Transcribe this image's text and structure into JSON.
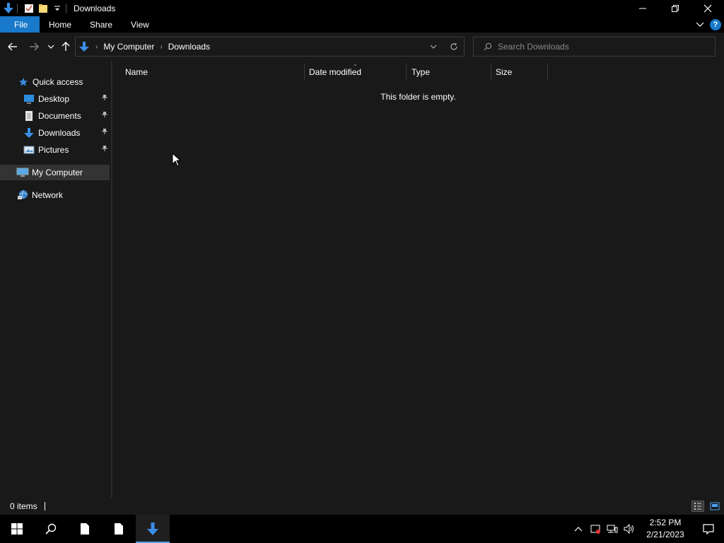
{
  "window": {
    "title": "Downloads",
    "controls": {
      "minimize": "—",
      "restore": "❐",
      "close": "✕"
    }
  },
  "ribbon": {
    "tabs": [
      "File",
      "Home",
      "Share",
      "View"
    ],
    "help": "?"
  },
  "address": {
    "crumbs": [
      "My Computer",
      "Downloads"
    ],
    "search_placeholder": "Search Downloads"
  },
  "nav": {
    "quick_access": "Quick access",
    "items": [
      {
        "label": "Desktop",
        "icon": "desktop-icon",
        "pinned": true
      },
      {
        "label": "Documents",
        "icon": "documents-icon",
        "pinned": true
      },
      {
        "label": "Downloads",
        "icon": "downloads-icon",
        "pinned": true
      },
      {
        "label": "Pictures",
        "icon": "pictures-icon",
        "pinned": true
      }
    ],
    "my_computer": "My Computer",
    "network": "Network"
  },
  "content": {
    "columns": [
      "Name",
      "Date modified",
      "Type",
      "Size"
    ],
    "empty_message": "This folder is empty."
  },
  "status": {
    "items_count": "0 items"
  },
  "taskbar": {
    "time": "2:52 PM",
    "date": "2/21/2023"
  },
  "colors": {
    "accent": "#1979ca",
    "background": "#191919",
    "chrome": "#000000",
    "selected": "#333333"
  }
}
